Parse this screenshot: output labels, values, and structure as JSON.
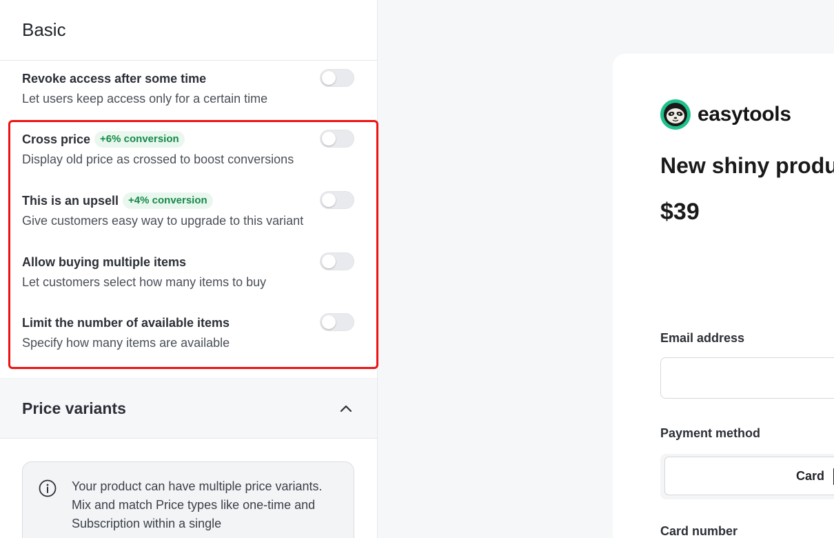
{
  "settings_panel": {
    "section_title": "Basic",
    "items": [
      {
        "label": "Revoke access after some time",
        "badge": "",
        "description": "Let users keep access only for a certain time",
        "enabled": false
      },
      {
        "label": "Cross price",
        "badge": "+6% conversion",
        "description": "Display old price as crossed to boost conversions",
        "enabled": false
      },
      {
        "label": "This is an upsell",
        "badge": "+4% conversion",
        "description": "Give customers easy way to upgrade to this variant",
        "enabled": false
      },
      {
        "label": "Allow buying multiple items",
        "badge": "",
        "description": "Let customers select how many items to buy",
        "enabled": false
      },
      {
        "label": "Limit the number of available items",
        "badge": "",
        "description": "Specify how many items are available",
        "enabled": false
      }
    ],
    "price_variants": {
      "title": "Price variants",
      "info_text": "Your product can have multiple price variants. Mix and match Price types like one-time and Subscription within a single"
    }
  },
  "checkout_preview": {
    "brand": "easytools",
    "product_name": "New shiny produ",
    "price": "$39",
    "email_label": "Email address",
    "email_value": "",
    "payment_method_label": "Payment method",
    "payment_option": "Card",
    "card_number_label": "Card number"
  },
  "colors": {
    "highlight": "#ee1111",
    "badge_text": "#138a48",
    "badge_bg": "#eaf7ee",
    "brand_accent": "#1ec28b"
  }
}
